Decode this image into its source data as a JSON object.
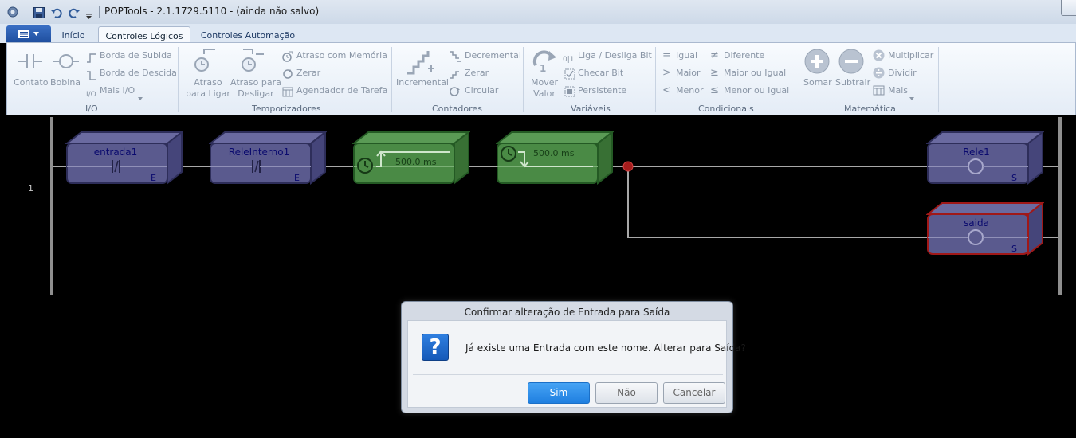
{
  "window": {
    "title": "POPTools - 2.1.1729.5110 - (ainda não salvo)"
  },
  "ribbon": {
    "tabs": [
      "Início",
      "Controles Lógicos",
      "Controles Automação"
    ],
    "active_tab": "Controles Lógicos",
    "groups": {
      "io": {
        "label": "I/O",
        "items": [
          "Contato",
          "Bobina",
          "Borda de Subida",
          "Borda de Descida",
          "Mais I/O"
        ]
      },
      "timers": {
        "label": "Temporizadores",
        "items": [
          "Atraso\npara Ligar",
          "Atraso para\nDesligar",
          "Atraso com Memória",
          "Zerar",
          "Agendador de Tarefa"
        ]
      },
      "counters": {
        "label": "Contadores",
        "items": [
          "Incremental",
          "Decremental",
          "Zerar",
          "Circular"
        ]
      },
      "variables": {
        "label": "Variáveis",
        "items": [
          "Mover\nValor",
          "Liga / Desliga Bit",
          "Checar Bit",
          "Persistente"
        ]
      },
      "conditionals": {
        "label": "Condicionais",
        "items": [
          "Igual",
          "Maior",
          "Menor",
          "Diferente",
          "Maior ou Igual",
          "Menor ou Igual"
        ]
      },
      "math": {
        "label": "Matemática",
        "items": [
          "Somar",
          "Subtrair",
          "Multiplicar",
          "Dividir",
          "Mais"
        ]
      }
    }
  },
  "ladder": {
    "rung_number": "1",
    "blocks": [
      {
        "name": "entrada1",
        "type_letter": "E"
      },
      {
        "name": "ReleInterno1",
        "type_letter": "E"
      },
      {
        "timer_value": "500.0 ms"
      },
      {
        "timer_value": "500.0 ms"
      },
      {
        "name": "Rele1",
        "type_letter": "S"
      },
      {
        "name": "saida",
        "type_letter": "S"
      }
    ]
  },
  "dialog": {
    "title": "Confirmar alteração de Entrada para Saída",
    "message": "Já existe uma Entrada com este nome. Alterar para Saída?",
    "buttons": [
      "Sim",
      "Não",
      "Cancelar"
    ]
  },
  "colors": {
    "block_fill": "#5a5a8e",
    "timer_fill": "#4a8a45",
    "selected_outline": "#a01818",
    "primary_button": "#1f7fe0"
  }
}
